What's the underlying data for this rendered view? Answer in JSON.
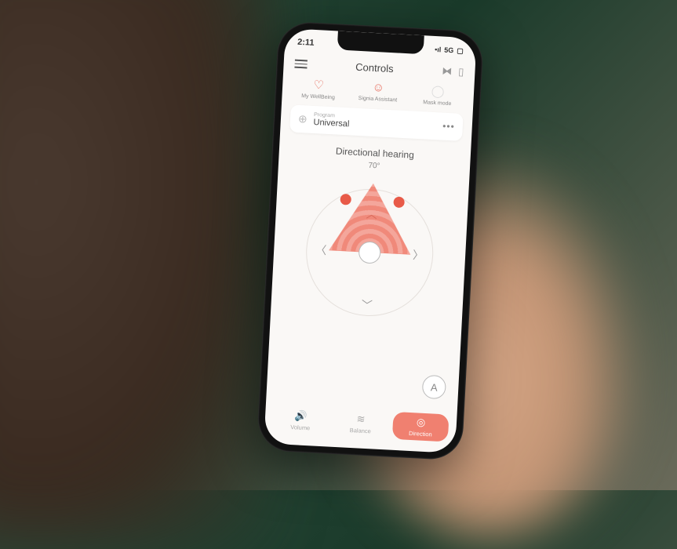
{
  "status": {
    "time": "2:11",
    "network": "5G"
  },
  "header": {
    "title": "Controls"
  },
  "quick": {
    "items": [
      {
        "label": "My WellBeing",
        "icon": "♡"
      },
      {
        "label": "Signia Assistant",
        "icon": "☺"
      },
      {
        "label": "Mask mode",
        "icon": "◯"
      }
    ]
  },
  "program": {
    "label": "Program",
    "name": "Universal"
  },
  "directional": {
    "title": "Directional hearing",
    "angle": "70°"
  },
  "auto": {
    "label": "A"
  },
  "tabs": {
    "items": [
      {
        "label": "Volume",
        "icon": "🔊"
      },
      {
        "label": "Balance",
        "icon": "≋"
      },
      {
        "label": "Direction",
        "icon": "◎"
      }
    ],
    "activeIndex": 2
  },
  "colors": {
    "accent": "#f08070",
    "accentDark": "#e85a48"
  }
}
